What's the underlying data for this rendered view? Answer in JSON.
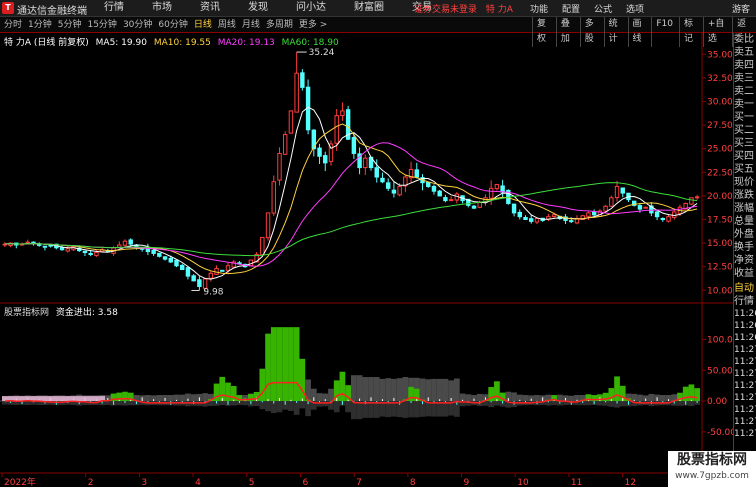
{
  "app": {
    "title": "通达信金融终端",
    "logo": "T",
    "menu": [
      "行情",
      "市场",
      "资讯",
      "发现",
      "问小达",
      "财富圈",
      "交易"
    ],
    "warning": "证券交易未登录",
    "stock_name_top": "特 力A",
    "right_items": [
      "功能",
      "配置",
      "公式",
      "选项"
    ],
    "guest": "游客"
  },
  "toolbar": {
    "periods": [
      "分时",
      "1分钟",
      "5分钟",
      "15分钟",
      "30分钟",
      "60分钟",
      "日线",
      "周线",
      "月线",
      "多周期",
      "更多 >"
    ],
    "active_period": 6,
    "tools": [
      "复权",
      "叠加",
      "多股",
      "统计",
      "画线",
      "F10",
      "标记",
      "+自选",
      "返回"
    ]
  },
  "kline_header": {
    "stock": "特 力A (日线 前复权)",
    "ma5": "MA5: 19.90",
    "ma10": "MA10: 19.55",
    "ma20": "MA20: 19.13",
    "ma60": "MA60: 18.90",
    "colors": {
      "ma5": "#ffffff",
      "ma10": "#ffd23c",
      "ma20": "#ff3cff",
      "ma60": "#3cdc3c"
    }
  },
  "indicator_header": {
    "name": "股票指标网",
    "value": "资金进出: 3.58"
  },
  "side_panel": {
    "labels": [
      "委比",
      "卖五",
      "卖四",
      "卖三",
      "卖二",
      "卖一",
      "买一",
      "买二",
      "买三",
      "买四",
      "买五",
      "现价",
      "涨跌",
      "涨幅",
      "总量",
      "外盘",
      "换手",
      "净资",
      "收益"
    ],
    "auto": "自动",
    "quote": "行情",
    "times": [
      "11:26",
      "11:26",
      "11:26",
      "11:27",
      "11:27",
      "11:27",
      "11:27",
      "11:27",
      "11:27",
      "11:27",
      "11:27"
    ]
  },
  "watermark": {
    "line1": "股票指标网",
    "line2": "www.7gpzb.com"
  },
  "chart_data": [
    {
      "type": "candlestick",
      "title": "特 力A (日线 前复权)",
      "y_ticks": [
        "35.00",
        "32.50",
        "30.00",
        "27.50",
        "25.00",
        "22.50",
        "20.00",
        "17.50",
        "15.00",
        "12.50",
        "10.00"
      ],
      "ylim": [
        9.5,
        36.2
      ],
      "x_labels": [
        "2022年",
        "2",
        "3",
        "4",
        "5",
        "6",
        "7",
        "8",
        "9",
        "10",
        "11",
        "12",
        "1"
      ],
      "annotations": [
        {
          "text": "35.24",
          "type": "high"
        },
        {
          "text": "9.98",
          "type": "low"
        }
      ],
      "close": [
        14.9,
        15.0,
        14.8,
        14.9,
        15.1,
        15.0,
        14.8,
        14.6,
        14.7,
        14.5,
        14.3,
        14.4,
        14.6,
        14.2,
        14.0,
        13.8,
        14.0,
        14.3,
        14.1,
        14.5,
        14.8,
        15.2,
        14.9,
        14.6,
        14.4,
        14.1,
        13.9,
        13.6,
        13.3,
        13.0,
        12.6,
        12.2,
        11.5,
        11.0,
        10.4,
        11.2,
        11.8,
        12.3,
        12.1,
        12.6,
        13.0,
        12.8,
        12.5,
        13.2,
        13.8,
        15.6,
        18.2,
        21.5,
        24.5,
        26.5,
        29.0,
        33.0,
        31.5,
        27.0,
        25.0,
        24.2,
        23.5,
        25.5,
        28.5,
        29.0,
        26.0,
        24.5,
        23.0,
        24.0,
        23.0,
        22.0,
        21.5,
        20.8,
        20.3,
        21.0,
        22.0,
        22.8,
        22.0,
        21.4,
        21.0,
        20.5,
        20.0,
        19.5,
        19.6,
        20.2,
        19.5,
        19.0,
        18.7,
        19.3,
        19.8,
        20.8,
        21.2,
        20.4,
        19.2,
        18.2,
        17.8,
        17.5,
        17.3,
        17.6,
        17.4,
        17.8,
        18.0,
        17.6,
        17.4,
        17.3,
        17.6,
        17.9,
        18.2,
        18.0,
        18.4,
        18.9,
        19.8,
        21.0,
        20.3,
        19.6,
        19.0,
        18.6,
        18.8,
        18.2,
        17.8,
        17.5,
        17.8,
        18.3,
        18.8,
        19.2,
        19.8,
        19.9
      ]
    },
    {
      "type": "area",
      "title": "资金进出",
      "y_ticks": [
        "100.00",
        "50.00",
        "0.00",
        "-50.00"
      ],
      "ylim": [
        -60,
        130
      ],
      "value": 3.58
    }
  ]
}
